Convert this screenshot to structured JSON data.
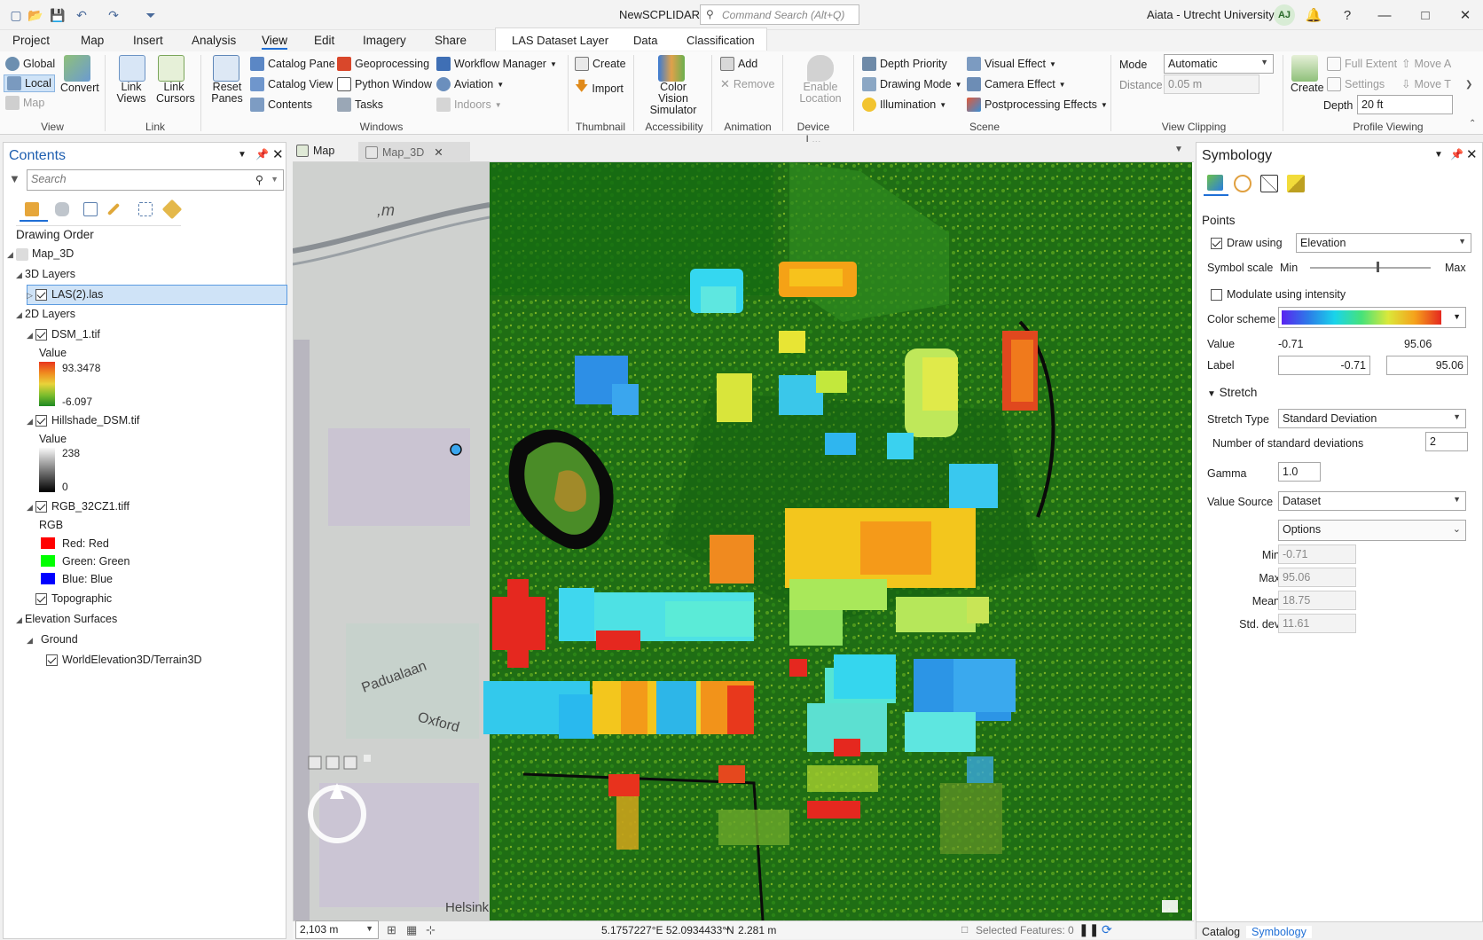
{
  "titlebar": {
    "app_title": "NewSCPLIDAR",
    "command_search_placeholder": "Command Search (Alt+Q)",
    "user_name": "Aiata - Utrecht University",
    "avatar_initials": "AJ"
  },
  "menu": {
    "tabs": [
      "Project",
      "Map",
      "Insert",
      "Analysis",
      "View",
      "Edit",
      "Imagery",
      "Share"
    ],
    "active_tab": "View",
    "context_group": "LAS Dataset Layer",
    "context_tabs": [
      "Data",
      "Classification"
    ]
  },
  "ribbon": {
    "view": {
      "global": "Global",
      "local": "Local",
      "map": "Map",
      "convert": "Convert",
      "group": "View"
    },
    "link": {
      "link_views": "Link Views",
      "link_cursors": "Link Cursors",
      "group": "Link"
    },
    "windows": {
      "reset_panes": "Reset Panes",
      "catalog_pane": "Catalog Pane",
      "catalog_view": "Catalog View",
      "contents": "Contents",
      "geoprocessing": "Geoprocessing",
      "python_window": "Python Window",
      "tasks": "Tasks",
      "workflow_manager": "Workflow Manager",
      "aviation": "Aviation",
      "indoors": "Indoors",
      "group": "Windows"
    },
    "thumbnail": {
      "create": "Create",
      "import": "Import",
      "group": "Thumbnail"
    },
    "accessibility": {
      "color_vision": "Color Vision Simulator",
      "group": "Accessibility"
    },
    "animation": {
      "add": "Add",
      "remove": "Remove",
      "group": "Animation"
    },
    "device": {
      "enable_location": "Enable Location",
      "group": "Device L..."
    },
    "scene": {
      "depth_priority": "Depth Priority",
      "drawing_mode": "Drawing Mode",
      "illumination": "Illumination",
      "visual_effect": "Visual Effect",
      "camera_effect": "Camera Effect",
      "postprocessing": "Postprocessing Effects",
      "group": "Scene"
    },
    "view_clipping": {
      "mode_label": "Mode",
      "mode_value": "Automatic",
      "distance_label": "Distance",
      "distance_value": "0.05  m",
      "group": "View Clipping"
    },
    "profile": {
      "create": "Create",
      "full_extent": "Full Extent",
      "settings": "Settings",
      "move_a": "Move A",
      "move_t": "Move T",
      "depth_label": "Depth",
      "depth_value": "20 ft",
      "group": "Profile Viewing"
    }
  },
  "contents": {
    "title": "Contents",
    "search_placeholder": "Search",
    "drawing_order": "Drawing Order",
    "map_name": "Map_3D",
    "layers_3d": "3D Layers",
    "las_layer": "LAS(2).las",
    "layers_2d": "2D Layers",
    "dsm": {
      "name": "DSM_1.tif",
      "value_label": "Value",
      "max": "93.3478",
      "min": "-6.097"
    },
    "hillshade": {
      "name": "Hillshade_DSM.tif",
      "value_label": "Value",
      "max": "238",
      "min": "0"
    },
    "rgb": {
      "name": "RGB_32CZ1.tiff",
      "label": "RGB",
      "red": "Red:   Red",
      "green": "Green: Green",
      "blue": "Blue:  Blue"
    },
    "topographic": "Topographic",
    "elevation_surfaces": "Elevation Surfaces",
    "ground": "Ground",
    "world_elevation": "WorldElevation3D/Terrain3D"
  },
  "mapview": {
    "tabs": [
      "Map",
      "Map_3D"
    ],
    "active_tab": "Map_3D",
    "street_labels": [
      "Padualaan",
      "Oxford",
      "Helsink"
    ],
    "scale": "2,103 m",
    "coordinates": "5.1757227°E 52.0934433°N",
    "elevation": "2.281 m",
    "selected_features": "Selected Features: 0"
  },
  "symbology": {
    "title": "Symbology",
    "section_points": "Points",
    "draw_using_label": "Draw using",
    "draw_using_value": "Elevation",
    "symbol_scale_label": "Symbol scale",
    "symbol_scale_min": "Min",
    "symbol_scale_max": "Max",
    "symbol_scale_fraction": 0.55,
    "modulate_intensity": "Modulate using intensity",
    "color_scheme_label": "Color scheme",
    "value_label": "Value",
    "value_min": "-0.71",
    "value_max": "95.06",
    "label_label": "Label",
    "label_min": "-0.71",
    "label_max": "95.06",
    "stretch_section": "Stretch",
    "stretch_type_label": "Stretch Type",
    "stretch_type_value": "Standard Deviation",
    "num_std_label": "Number of standard deviations",
    "num_std_value": "2",
    "gamma_label": "Gamma",
    "gamma_value": "1.0",
    "value_source_label": "Value Source",
    "value_source_value": "Dataset",
    "options": "Options",
    "stats": {
      "min_label": "Min",
      "min": "-0.71",
      "max_label": "Max",
      "max": "95.06",
      "mean_label": "Mean",
      "mean": "18.75",
      "std_label": "Std. dev",
      "std": "11.61"
    },
    "bottom_tabs": [
      "Catalog",
      "Symbology"
    ]
  },
  "colors": {
    "accent": "#1f6fd6",
    "map_green": "#1c6a12"
  }
}
